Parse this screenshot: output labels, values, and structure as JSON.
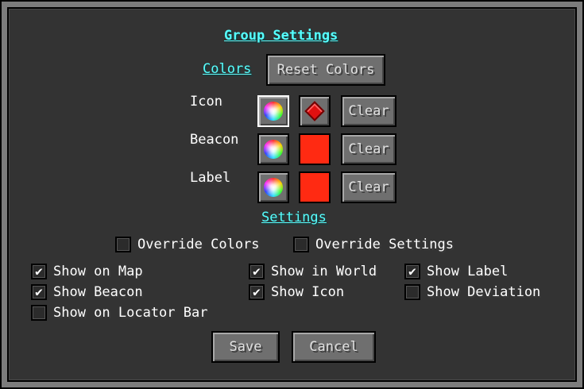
{
  "title": "Group Settings",
  "colors": {
    "section_label": "Colors",
    "reset_label": "Reset Colors",
    "rows": [
      {
        "label": "Icon",
        "clear": "Clear",
        "color": "#ff2a12"
      },
      {
        "label": "Beacon",
        "clear": "Clear",
        "color": "#ff2a12"
      },
      {
        "label": "Label",
        "clear": "Clear",
        "color": "#ff2a12"
      }
    ]
  },
  "settings": {
    "section_label": "Settings",
    "override_colors": {
      "label": "Override Colors",
      "checked": false
    },
    "override_settings": {
      "label": "Override Settings",
      "checked": false
    },
    "options": [
      {
        "label": "Show on Map",
        "checked": true
      },
      {
        "label": "Show in World",
        "checked": true
      },
      {
        "label": "Show Label",
        "checked": true
      },
      {
        "label": "Show Beacon",
        "checked": true
      },
      {
        "label": "Show Icon",
        "checked": true
      },
      {
        "label": "Show Deviation",
        "checked": false
      },
      {
        "label": "Show on Locator Bar",
        "checked": false
      }
    ]
  },
  "footer": {
    "save_label": "Save",
    "cancel_label": "Cancel"
  },
  "check_mark": "✔",
  "icons": {
    "picker": "color-wheel-icon",
    "marker": "red-diamond-icon"
  },
  "accent_color": "#55ffff"
}
